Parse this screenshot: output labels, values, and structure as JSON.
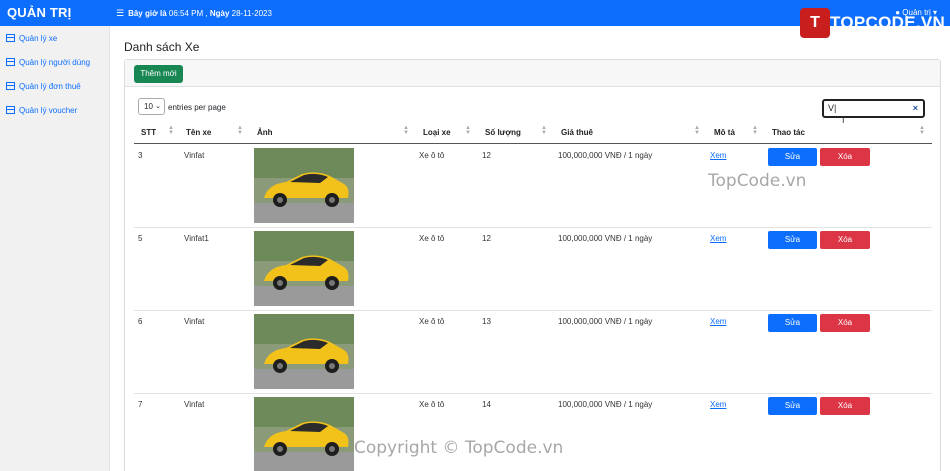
{
  "topbar": {
    "brand": "QUẢN TRỊ",
    "menu_icon": "☰",
    "clock_prefix": "Bây giờ là",
    "clock_time": "06:54 PM",
    "clock_day_label": "Ngày",
    "clock_date": "28-11-2023",
    "user_label": "Quản trị"
  },
  "logo": {
    "mark": "T",
    "text": "TOPCODE.VN"
  },
  "sidebar": {
    "items": [
      {
        "label": "Quản lý xe"
      },
      {
        "label": "Quản lý người dùng"
      },
      {
        "label": "Quản lý đơn thuê"
      },
      {
        "label": "Quản lý voucher"
      }
    ]
  },
  "main": {
    "title": "Danh sách Xe",
    "add_button": "Thêm mới",
    "entries_value": "10",
    "entries_label": "entries per page",
    "search_value": "V|"
  },
  "table": {
    "headers": [
      "STT",
      "Tên xe",
      "Ảnh",
      "Loại xe",
      "Số lượng",
      "Giá thuê",
      "Mô tả",
      "Thao tác"
    ],
    "rows": [
      {
        "stt": "3",
        "name": "Vinfat",
        "type": "Xe ô tô",
        "qty": "12",
        "price": "100,000,000 VNĐ / 1 ngày",
        "desc": "Xem",
        "edit": "Sửa",
        "delete": "Xóa"
      },
      {
        "stt": "5",
        "name": "Vinfat1",
        "type": "Xe ô tô",
        "qty": "12",
        "price": "100,000,000 VNĐ / 1 ngày",
        "desc": "Xem",
        "edit": "Sửa",
        "delete": "Xóa"
      },
      {
        "stt": "6",
        "name": "Vinfat",
        "type": "Xe ô tô",
        "qty": "13",
        "price": "100,000,000 VNĐ / 1 ngày",
        "desc": "Xem",
        "edit": "Sửa",
        "delete": "Xóa"
      },
      {
        "stt": "7",
        "name": "Vinfat",
        "type": "Xe ô tô",
        "qty": "14",
        "price": "100,000,000 VNĐ / 1 ngày",
        "desc": "Xem",
        "edit": "Sửa",
        "delete": "Xóa"
      }
    ]
  },
  "watermark": {
    "middle": "TopCode.vn",
    "bottom": "Copyright © TopCode.vn"
  },
  "colors": {
    "primary": "#0d6efd",
    "success": "#198754",
    "danger": "#dc3545",
    "car_body": "#f2c21b"
  }
}
